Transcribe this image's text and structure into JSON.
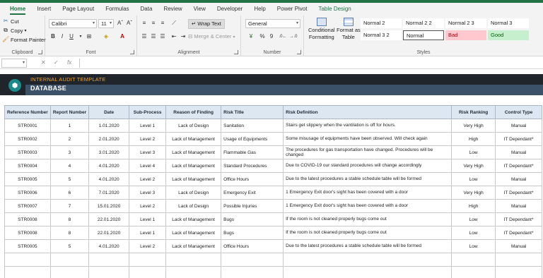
{
  "ribbon": {
    "tabs": [
      "Home",
      "Insert",
      "Page Layout",
      "Formulas",
      "Data",
      "Review",
      "View",
      "Developer",
      "Help",
      "Power Pivot",
      "Table Design"
    ],
    "clipboard": {
      "cut": "Cut",
      "copy": "Copy",
      "format_painter": "Format Painter",
      "label": "Clipboard"
    },
    "font": {
      "name": "Calibri",
      "size": "11",
      "label": "Font",
      "bold": "B",
      "italic": "I",
      "underline": "U",
      "grow": "Aˆ",
      "shrink": "Aˇ"
    },
    "alignment": {
      "wrap_text": "Wrap Text",
      "merge_center": "Merge & Center",
      "label": "Alignment"
    },
    "number": {
      "format": "General",
      "label": "Number",
      "currency": "¥",
      "percent": "%",
      "comma": "9"
    },
    "styles": {
      "conditional_formatting": [
        "Conditional",
        "Formatting"
      ],
      "format_as_table": [
        "Format as",
        "Table"
      ],
      "label": "Styles",
      "cells": [
        "Normal 2",
        "Normal 2 2",
        "Normal 2 3",
        "Normal 3",
        "Normal 3 2",
        "Normal",
        "Bad",
        "Good"
      ]
    }
  },
  "formula_bar": {
    "cancel": "✕",
    "enter": "✓",
    "fx": "fx",
    "value": ""
  },
  "header": {
    "subtitle": "INTERNAL AUDIT TEMPLATE",
    "title": "DATABASE"
  },
  "table": {
    "columns": [
      "Reference Number",
      "Report Number",
      "Date",
      "Sub-Process",
      "Reason of Finding",
      "Risk Title",
      "Risk Definition",
      "Risk Ranking",
      "Control Type"
    ],
    "rows": [
      [
        "STR0001",
        "1",
        "1.01.2020",
        "Level 1",
        "Lack of Design",
        "Sanitation",
        "Stairs get slippery when the vantilation is off for hours.",
        "Very High",
        "Manual"
      ],
      [
        "STR0002",
        "2",
        "2.01.2020",
        "Level 2",
        "Lack of Management",
        "Usage of Equipments",
        "Some misusage of equipments have been observed. Will check again",
        "High",
        "IT Dependant*"
      ],
      [
        "STR0003",
        "3",
        "3.01.2020",
        "Level 3",
        "Lack of Management",
        "Flammable Gas",
        "The procedures for gas transportation have changed. Procedures will be changed",
        "Low",
        "Manual"
      ],
      [
        "STR0004",
        "4",
        "4.01.2020",
        "Level 4",
        "Lack of Management",
        "Standard Procedures",
        "Due to COVID-19 our standard procedures will change accordingly",
        "Very High",
        "IT Dependant*"
      ],
      [
        "STR0005",
        "5",
        "4.01.2020",
        "Level 2",
        "Lack of Management",
        "Office Hours",
        "Due to the latest procedures a stable schedule table will be formed",
        "Low",
        "Manual"
      ],
      [
        "STR0006",
        "6",
        "7.01.2020",
        "Level 3",
        "Lack of Design",
        "Emergency Exit",
        "1 Emergency Exit door's sight has been covered with a door",
        "Very High",
        "IT Dependant*"
      ],
      [
        "STR0007",
        "7",
        "15.01.2020",
        "Level 2",
        "Lack of Design",
        "Possible Injuries",
        "1 Emergency Exit door's sight has been covered with a door",
        "High",
        "Manual"
      ],
      [
        "STR0008",
        "8",
        "22.01.2020",
        "Level 1",
        "Lack of Management",
        "Bugs",
        "If the room is not cleaned properly bugs come out",
        "Low",
        "IT Dependant*"
      ],
      [
        "STR0008",
        "8",
        "22.01.2020",
        "Level 1",
        "Lack of Management",
        "Bugs",
        "If the room is not cleaned properly bugs come out",
        "Low",
        "IT Dependant*"
      ],
      [
        "STR0005",
        "5",
        "4.01.2020",
        "Level 2",
        "Lack of Management",
        "Office Hours",
        "Due to the latest procedures a stable schedule table will be formed",
        "Low",
        "Manual"
      ],
      [
        "",
        "",
        "",
        "",
        "",
        "",
        "",
        "",
        ""
      ],
      [
        "",
        "",
        "",
        "",
        "",
        "",
        "",
        "",
        ""
      ]
    ]
  },
  "colors": {
    "accent": "#217346",
    "banner": "#20242b",
    "banner_subtitle": "#f0a52b",
    "header_fill": "#dde7f1"
  }
}
